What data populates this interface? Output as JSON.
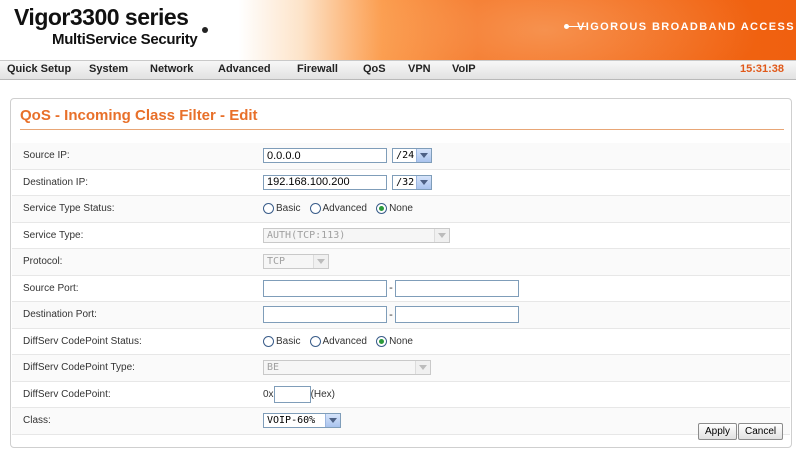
{
  "header": {
    "logo_line1": "Vigor3300 series",
    "logo_line2": "MultiService Security",
    "tagline": "VIGOROUS BROADBAND ACCESS"
  },
  "menu": {
    "items": [
      "Quick Setup",
      "System",
      "Network",
      "Advanced",
      "Firewall",
      "QoS",
      "VPN",
      "VoIP"
    ],
    "clock": "15:31:38"
  },
  "page": {
    "title": "QoS - Incoming Class Filter - Edit"
  },
  "form": {
    "source_ip": {
      "label": "Source IP:",
      "value": "0.0.0.0",
      "mask": "/24"
    },
    "destination_ip": {
      "label": "Destination IP:",
      "value": "192.168.100.200",
      "mask": "/32"
    },
    "service_type_status": {
      "label": "Service Type Status:",
      "options": [
        "Basic",
        "Advanced",
        "None"
      ],
      "selected": "None"
    },
    "service_type": {
      "label": "Service Type:",
      "value": "AUTH(TCP:113)"
    },
    "protocol": {
      "label": "Protocol:",
      "value": "TCP"
    },
    "source_port": {
      "label": "Source Port:",
      "separator": "-",
      "start": "",
      "end": ""
    },
    "destination_port": {
      "label": "Destination Port:",
      "separator": "-",
      "start": "",
      "end": ""
    },
    "diffserv_status": {
      "label": "DiffServ CodePoint Status:",
      "options": [
        "Basic",
        "Advanced",
        "None"
      ],
      "selected": "None"
    },
    "diffserv_type": {
      "label": "DiffServ CodePoint Type:",
      "value": "BE"
    },
    "diffserv_codepoint": {
      "label": "DiffServ CodePoint:",
      "prefix": "0x",
      "value": "",
      "suffix": "(Hex)"
    },
    "class": {
      "label": "Class:",
      "value": "VOIP-60%"
    }
  },
  "buttons": {
    "apply": "Apply",
    "cancel": "Cancel"
  }
}
